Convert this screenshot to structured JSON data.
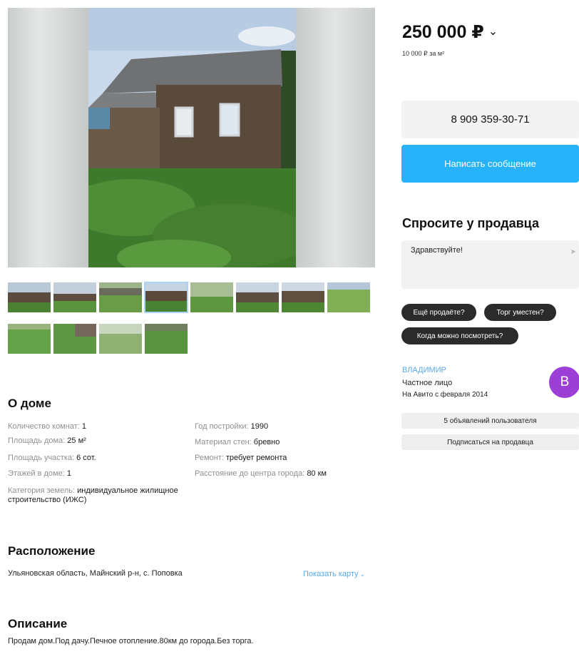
{
  "listing": {
    "price": "250 000 ₽",
    "price_per_m2": "10 000 ₽ за м²"
  },
  "photos": {
    "main_alt": "photo-of-wooden-house",
    "thumb_count": 12,
    "active_thumb": 3
  },
  "contact": {
    "phone": "8 909 359-30-71",
    "message_button": "Написать сообщение"
  },
  "ask": {
    "title": "Спросите у продавца",
    "message_value": "Здравствуйте!",
    "chips": [
      "Ещё продаёте?",
      "Торг уместен?",
      "Когда можно посмотреть?"
    ]
  },
  "seller": {
    "name": "ВЛАДИМИР",
    "type": "Частное лицо",
    "since": "На Авито с февраля 2014",
    "avatar_letter": "В",
    "avatar_color": "#9b3fd7",
    "listings_button": "5 объявлений пользователя",
    "subscribe_button": "Подписаться на продавца"
  },
  "about": {
    "title": "О доме",
    "left": [
      {
        "key": "Количество комнат:",
        "value": "1"
      },
      {
        "key": "Площадь дома:",
        "value": "25 м²"
      },
      {
        "key": "Площадь участка:",
        "value": "6 сот."
      },
      {
        "key": "Этажей в доме:",
        "value": "1"
      },
      {
        "key": "Категория земель:",
        "value": "индивидуальное жилищное строительство (ИЖС)"
      }
    ],
    "right": [
      {
        "key": "Год постройки:",
        "value": "1990"
      },
      {
        "key": "Материал стен:",
        "value": "бревно"
      },
      {
        "key": "Ремонт:",
        "value": "требует ремонта"
      },
      {
        "key": "Расстояние до центра города:",
        "value": "80 км"
      }
    ]
  },
  "location": {
    "title": "Расположение",
    "address": "Ульяновская область, Майнский р-н, с. Поповка",
    "map_link": "Показать карту"
  },
  "description": {
    "title": "Описание",
    "text": "Продам дом.Под дачу.Печное отопление.80км до города.Без торга."
  },
  "colors": {
    "accent_blue": "#27b2f9",
    "link_blue": "#5aa8e8",
    "chip_dark": "#2b2b2b"
  }
}
